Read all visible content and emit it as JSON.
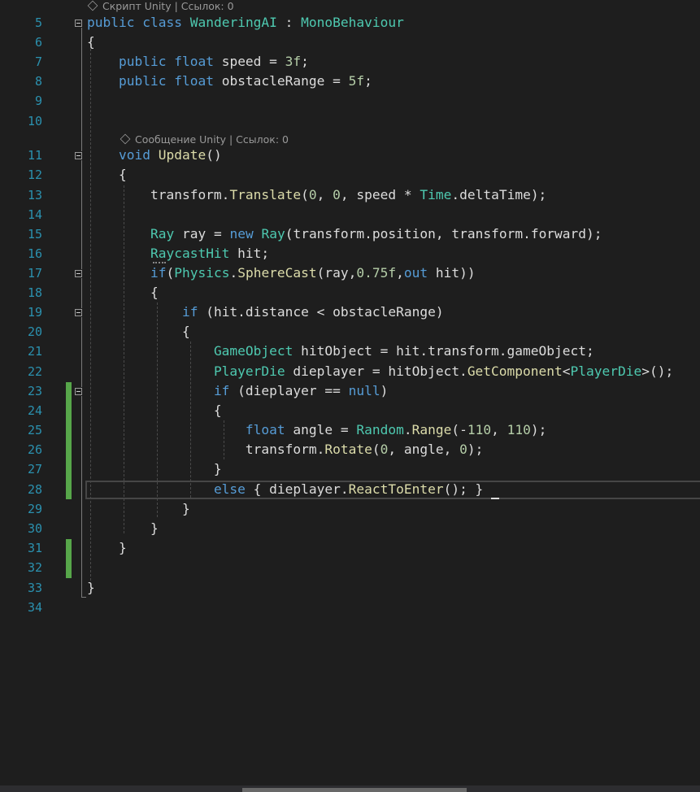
{
  "codelens": {
    "class_lens": "Скрипт Unity | Ссылок: 0",
    "method_lens": "Сообщение Unity | Ссылок: 0"
  },
  "lines": [
    {
      "n": "5",
      "tokens": [
        {
          "c": "kw",
          "t": "public"
        },
        {
          "c": "pl",
          "t": " "
        },
        {
          "c": "kw",
          "t": "class"
        },
        {
          "c": "pl",
          "t": " "
        },
        {
          "c": "ty",
          "t": "WanderingAI"
        },
        {
          "c": "pl",
          "t": " : "
        },
        {
          "c": "ty",
          "t": "MonoBehaviour"
        }
      ]
    },
    {
      "n": "6",
      "tokens": [
        {
          "c": "pl",
          "t": "{"
        }
      ]
    },
    {
      "n": "7",
      "tokens": [
        {
          "c": "pl",
          "t": "    "
        },
        {
          "c": "kw",
          "t": "public"
        },
        {
          "c": "pl",
          "t": " "
        },
        {
          "c": "kw",
          "t": "float"
        },
        {
          "c": "pl",
          "t": " speed = "
        },
        {
          "c": "num",
          "t": "3f"
        },
        {
          "c": "pl",
          "t": ";"
        }
      ]
    },
    {
      "n": "8",
      "tokens": [
        {
          "c": "pl",
          "t": "    "
        },
        {
          "c": "kw",
          "t": "public"
        },
        {
          "c": "pl",
          "t": " "
        },
        {
          "c": "kw",
          "t": "float"
        },
        {
          "c": "pl",
          "t": " obstacleRange = "
        },
        {
          "c": "num",
          "t": "5f"
        },
        {
          "c": "pl",
          "t": ";"
        }
      ]
    },
    {
      "n": "9",
      "tokens": []
    },
    {
      "n": "10",
      "tokens": []
    },
    {
      "n": "11",
      "tokens": [
        {
          "c": "pl",
          "t": "    "
        },
        {
          "c": "kw",
          "t": "void"
        },
        {
          "c": "pl",
          "t": " "
        },
        {
          "c": "fn",
          "t": "Update"
        },
        {
          "c": "pl",
          "t": "()"
        }
      ]
    },
    {
      "n": "12",
      "tokens": [
        {
          "c": "pl",
          "t": "    {"
        }
      ]
    },
    {
      "n": "13",
      "tokens": [
        {
          "c": "pl",
          "t": "        transform."
        },
        {
          "c": "fn",
          "t": "Translate"
        },
        {
          "c": "pl",
          "t": "("
        },
        {
          "c": "num",
          "t": "0"
        },
        {
          "c": "pl",
          "t": ", "
        },
        {
          "c": "num",
          "t": "0"
        },
        {
          "c": "pl",
          "t": ", speed * "
        },
        {
          "c": "ty",
          "t": "Time"
        },
        {
          "c": "pl",
          "t": ".deltaTime);"
        }
      ]
    },
    {
      "n": "14",
      "tokens": []
    },
    {
      "n": "15",
      "tokens": [
        {
          "c": "pl",
          "t": "        "
        },
        {
          "c": "ty",
          "t": "Ray"
        },
        {
          "c": "pl",
          "t": " ray = "
        },
        {
          "c": "kw",
          "t": "new"
        },
        {
          "c": "pl",
          "t": " "
        },
        {
          "c": "ty",
          "t": "Ray"
        },
        {
          "c": "pl",
          "t": "(transform.position, transform.forward);"
        }
      ]
    },
    {
      "n": "16",
      "tokens": [
        {
          "c": "pl",
          "t": "        "
        },
        {
          "c": "ty",
          "t": "RaycastHit"
        },
        {
          "c": "pl",
          "t": " hit;"
        }
      ]
    },
    {
      "n": "17",
      "tokens": [
        {
          "c": "pl",
          "t": "        "
        },
        {
          "c": "kw",
          "t": "if"
        },
        {
          "c": "pl",
          "t": "("
        },
        {
          "c": "ty",
          "t": "Physics"
        },
        {
          "c": "pl",
          "t": "."
        },
        {
          "c": "fn",
          "t": "SphereCast"
        },
        {
          "c": "pl",
          "t": "(ray,"
        },
        {
          "c": "num",
          "t": "0.75f"
        },
        {
          "c": "pl",
          "t": ","
        },
        {
          "c": "kw",
          "t": "out"
        },
        {
          "c": "pl",
          "t": " hit))"
        }
      ]
    },
    {
      "n": "18",
      "tokens": [
        {
          "c": "pl",
          "t": "        {"
        }
      ]
    },
    {
      "n": "19",
      "tokens": [
        {
          "c": "pl",
          "t": "            "
        },
        {
          "c": "kw",
          "t": "if"
        },
        {
          "c": "pl",
          "t": " (hit.distance < obstacleRange)"
        }
      ]
    },
    {
      "n": "20",
      "tokens": [
        {
          "c": "pl",
          "t": "            {"
        }
      ]
    },
    {
      "n": "21",
      "tokens": [
        {
          "c": "pl",
          "t": "                "
        },
        {
          "c": "ty",
          "t": "GameObject"
        },
        {
          "c": "pl",
          "t": " hitObject = hit.transform.gameObject;"
        }
      ]
    },
    {
      "n": "22",
      "tokens": [
        {
          "c": "pl",
          "t": "                "
        },
        {
          "c": "ty",
          "t": "PlayerDie"
        },
        {
          "c": "pl",
          "t": " dieplayer = hitObject."
        },
        {
          "c": "fn",
          "t": "GetComponent"
        },
        {
          "c": "pl",
          "t": "<"
        },
        {
          "c": "ty",
          "t": "PlayerDie"
        },
        {
          "c": "pl",
          "t": ">();"
        }
      ]
    },
    {
      "n": "23",
      "tokens": [
        {
          "c": "pl",
          "t": "                "
        },
        {
          "c": "kw",
          "t": "if"
        },
        {
          "c": "pl",
          "t": " (dieplayer == "
        },
        {
          "c": "kw",
          "t": "null"
        },
        {
          "c": "pl",
          "t": ")"
        }
      ]
    },
    {
      "n": "24",
      "tokens": [
        {
          "c": "pl",
          "t": "                {"
        }
      ]
    },
    {
      "n": "25",
      "tokens": [
        {
          "c": "pl",
          "t": "                    "
        },
        {
          "c": "kw",
          "t": "float"
        },
        {
          "c": "pl",
          "t": " angle = "
        },
        {
          "c": "ty",
          "t": "Random"
        },
        {
          "c": "pl",
          "t": "."
        },
        {
          "c": "fn",
          "t": "Range"
        },
        {
          "c": "pl",
          "t": "(-"
        },
        {
          "c": "num",
          "t": "110"
        },
        {
          "c": "pl",
          "t": ", "
        },
        {
          "c": "num",
          "t": "110"
        },
        {
          "c": "pl",
          "t": ");"
        }
      ]
    },
    {
      "n": "26",
      "tokens": [
        {
          "c": "pl",
          "t": "                    transform."
        },
        {
          "c": "fn",
          "t": "Rotate"
        },
        {
          "c": "pl",
          "t": "("
        },
        {
          "c": "num",
          "t": "0"
        },
        {
          "c": "pl",
          "t": ", angle, "
        },
        {
          "c": "num",
          "t": "0"
        },
        {
          "c": "pl",
          "t": ");"
        }
      ]
    },
    {
      "n": "27",
      "tokens": [
        {
          "c": "pl",
          "t": "                }"
        }
      ]
    },
    {
      "n": "28",
      "tokens": [
        {
          "c": "pl",
          "t": "                "
        },
        {
          "c": "kw",
          "t": "else"
        },
        {
          "c": "pl",
          "t": " { dieplayer."
        },
        {
          "c": "fn",
          "t": "ReactToEnter"
        },
        {
          "c": "pl",
          "t": "(); }"
        }
      ]
    },
    {
      "n": "29",
      "tokens": [
        {
          "c": "pl",
          "t": "            }"
        }
      ]
    },
    {
      "n": "30",
      "tokens": [
        {
          "c": "pl",
          "t": "        }"
        }
      ]
    },
    {
      "n": "31",
      "tokens": [
        {
          "c": "pl",
          "t": "    }"
        }
      ]
    },
    {
      "n": "32",
      "tokens": []
    },
    {
      "n": "33",
      "tokens": [
        {
          "c": "pl",
          "t": "}"
        }
      ]
    },
    {
      "n": "34",
      "tokens": []
    }
  ]
}
